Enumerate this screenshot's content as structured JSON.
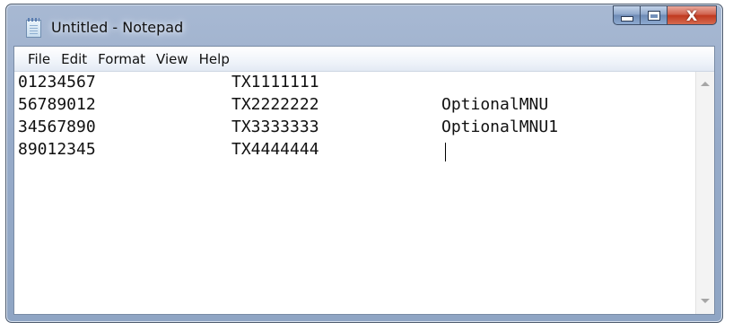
{
  "window": {
    "title": "Untitled - Notepad",
    "close_glyph": "X"
  },
  "menu": {
    "items": [
      "File",
      "Edit",
      "Format",
      "View",
      "Help"
    ]
  },
  "editor": {
    "lines": [
      [
        "01234567",
        "TX1111111",
        ""
      ],
      [
        "56789012",
        "TX2222222",
        "OptionalMNU"
      ],
      [
        "34567890",
        "TX3333333",
        "OptionalMNU1"
      ],
      [
        "89012345",
        "TX4444444",
        ""
      ]
    ]
  },
  "icons": {
    "app": "notepad-icon",
    "minimize": "minimize-icon",
    "maximize": "maximize-icon",
    "close": "close-icon",
    "scroll_up": "scroll-up-arrow-icon",
    "scroll_down": "scroll-down-arrow-icon"
  },
  "colors": {
    "titlebar": "#97abc9",
    "close_button": "#c0391f",
    "background": "#ffffff"
  }
}
